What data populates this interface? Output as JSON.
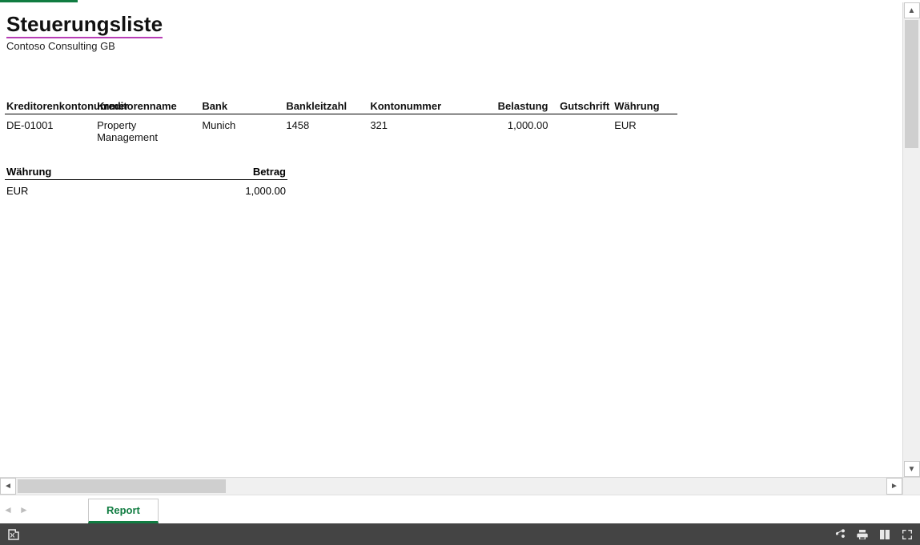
{
  "report": {
    "title": "Steuerungsliste",
    "company": "Contoso Consulting GB"
  },
  "main_table": {
    "headers": {
      "vendor_no": "Kreditorenkontonummer",
      "vendor_name": "Kreditorenname",
      "bank": "Bank",
      "bank_code": "Bankleitzahl",
      "account_no": "Kontonummer",
      "debit": "Belastung",
      "credit": "Gutschrift",
      "currency": "Währung"
    },
    "rows": [
      {
        "vendor_no": "DE-01001",
        "vendor_name": "Property Management",
        "bank": "Munich",
        "bank_code": "1458",
        "account_no": "321",
        "debit": "1,000.00",
        "credit": "",
        "currency": "EUR"
      }
    ]
  },
  "summary_table": {
    "headers": {
      "currency": "Währung",
      "amount": "Betrag"
    },
    "rows": [
      {
        "currency": "EUR",
        "amount": "1,000.00"
      }
    ]
  },
  "tabs": {
    "report": "Report"
  }
}
